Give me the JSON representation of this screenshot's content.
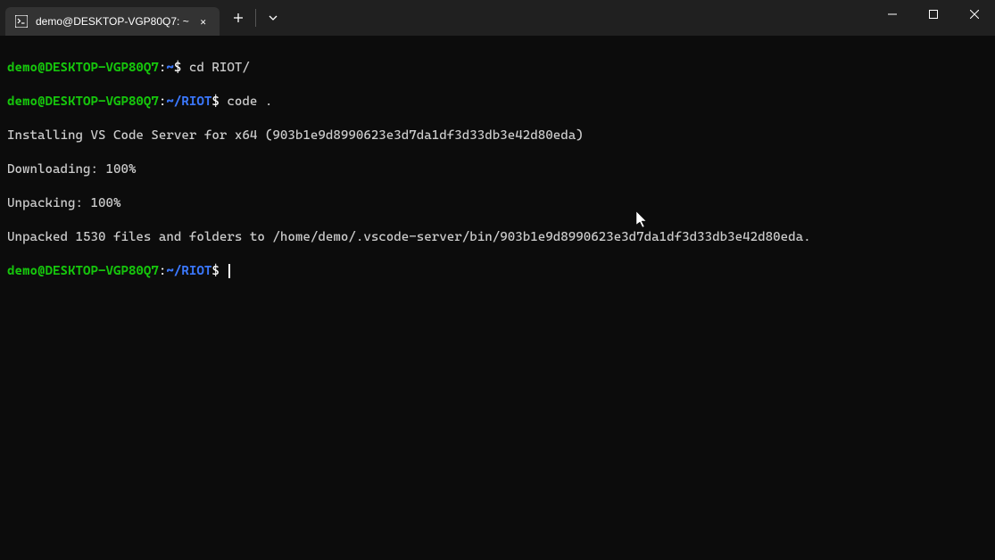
{
  "titlebar": {
    "tab_title": "demo@DESKTOP-VGP80Q7: ~",
    "close_glyph": "✕",
    "new_tab_glyph": "+",
    "dropdown_glyph": "⌄"
  },
  "window": {
    "minimize_glyph": "—",
    "maximize_glyph": "▢",
    "close_glyph": "✕"
  },
  "terminal": {
    "line1": {
      "user": "demo@DESKTOP-VGP80Q7",
      "colon": ":",
      "path_home": "~",
      "dollar": "$ ",
      "cmd": "cd RIOT/"
    },
    "line2": {
      "user": "demo@DESKTOP-VGP80Q7",
      "colon": ":",
      "path_home": "~",
      "path_dir": "/RIOT",
      "dollar": "$ ",
      "cmd": "code ."
    },
    "out1": "Installing VS Code Server for x64 (903b1e9d8990623e3d7da1df3d33db3e42d80eda)",
    "out2": "Downloading: 100%",
    "out3": "Unpacking: 100%",
    "out4": "Unpacked 1530 files and folders to /home/demo/.vscode-server/bin/903b1e9d8990623e3d7da1df3d33db3e42d80eda.",
    "line3": {
      "user": "demo@DESKTOP-VGP80Q7",
      "colon": ":",
      "path_home": "~",
      "path_dir": "/RIOT",
      "dollar": "$ "
    }
  }
}
